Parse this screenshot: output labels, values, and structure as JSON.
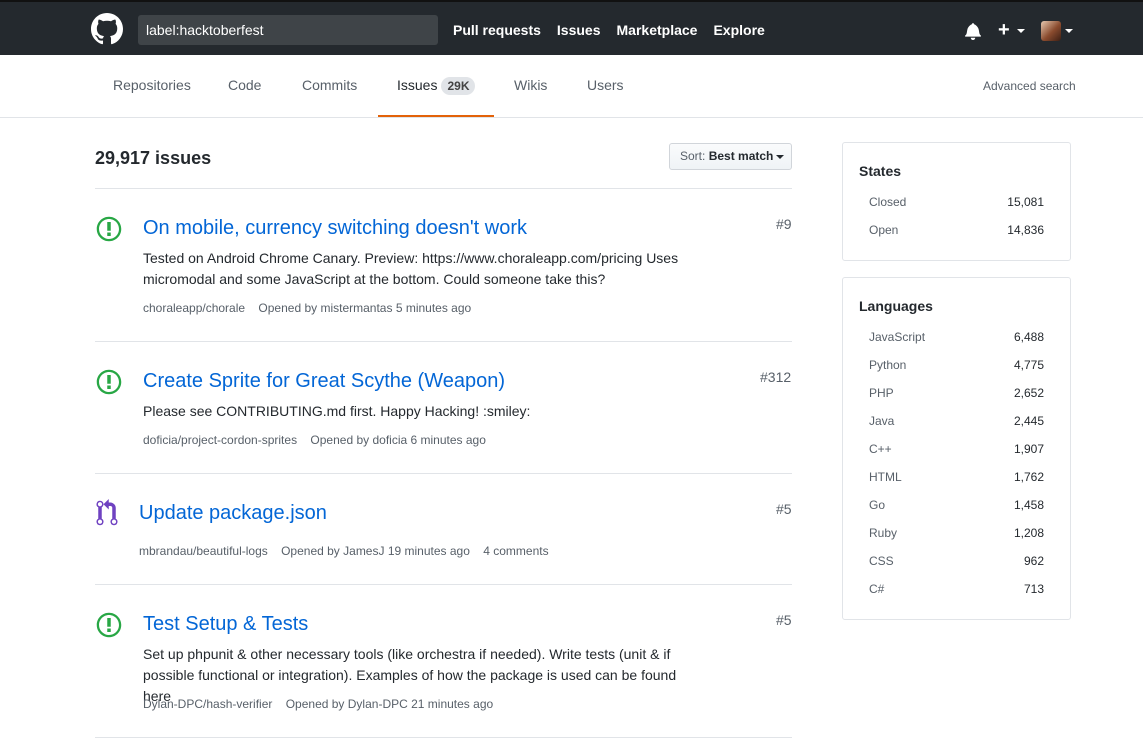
{
  "header": {
    "search_value": "label:hacktoberfest",
    "nav": [
      "Pull requests",
      "Issues",
      "Marketplace",
      "Explore"
    ],
    "plus": "+"
  },
  "subnav": {
    "tabs": [
      "Repositories",
      "Code",
      "Commits",
      "Issues",
      "Wikis",
      "Users"
    ],
    "issues_count_badge": "29K",
    "advanced_search": "Advanced search"
  },
  "results": {
    "count_label": "29,917 issues",
    "sort_prefix": "Sort:",
    "sort_value": "Best match"
  },
  "issues": [
    {
      "type": "issue-open",
      "title": "On mobile, currency switching doesn't work",
      "number": "#9",
      "body_line1": "Tested on Android Chrome Canary. Preview: https://www.choraleapp.com/pricing Uses",
      "body_line2": "micromodal and some JavaScript at the bottom. Could someone take this?",
      "repo": "choraleapp/chorale",
      "opened": "Opened by mistermantas 5 minutes ago"
    },
    {
      "type": "issue-open",
      "title": "Create Sprite for Great Scythe (Weapon)",
      "number": "#312",
      "body_line1": "Please see CONTRIBUTING.md first. Happy Hacking! :smiley:",
      "repo": "doficia/project-cordon-sprites",
      "opened": "Opened by doficia 6 minutes ago"
    },
    {
      "type": "pull-request",
      "title": "Update package.json",
      "number": "#5",
      "repo": "mbrandau/beautiful-logs",
      "opened": "Opened by JamesJ 19 minutes ago",
      "comments": "4 comments"
    },
    {
      "type": "issue-open",
      "title": "Test Setup & Tests",
      "number": "#5",
      "body_line1": "Set up phpunit & other necessary tools (like orchestra if needed). Write tests (unit & if",
      "body_line2": "possible functional or integration). Examples of how the package is used can be found here",
      "repo": "Dylan-DPC/hash-verifier",
      "opened": "Opened by Dylan-DPC 21 minutes ago"
    }
  ],
  "states": {
    "title": "States",
    "items": [
      {
        "label": "Closed",
        "count": "15,081"
      },
      {
        "label": "Open",
        "count": "14,836"
      }
    ]
  },
  "languages": {
    "title": "Languages",
    "items": [
      {
        "label": "JavaScript",
        "count": "6,488"
      },
      {
        "label": "Python",
        "count": "4,775"
      },
      {
        "label": "PHP",
        "count": "2,652"
      },
      {
        "label": "Java",
        "count": "2,445"
      },
      {
        "label": "C++",
        "count": "1,907"
      },
      {
        "label": "HTML",
        "count": "1,762"
      },
      {
        "label": "Go",
        "count": "1,458"
      },
      {
        "label": "Ruby",
        "count": "1,208"
      },
      {
        "label": "CSS",
        "count": "962"
      },
      {
        "label": "C#",
        "count": "713"
      }
    ]
  },
  "colors": {
    "header_bg": "#24292e",
    "link": "#0366d6",
    "open_green": "#28a745",
    "pr_purple": "#6f42c1",
    "active_tab": "#e36209"
  },
  "icons": [
    "github-logo-icon",
    "bell-icon",
    "plus-icon",
    "issue-opened-icon",
    "pull-request-icon",
    "caret-down-icon"
  ]
}
